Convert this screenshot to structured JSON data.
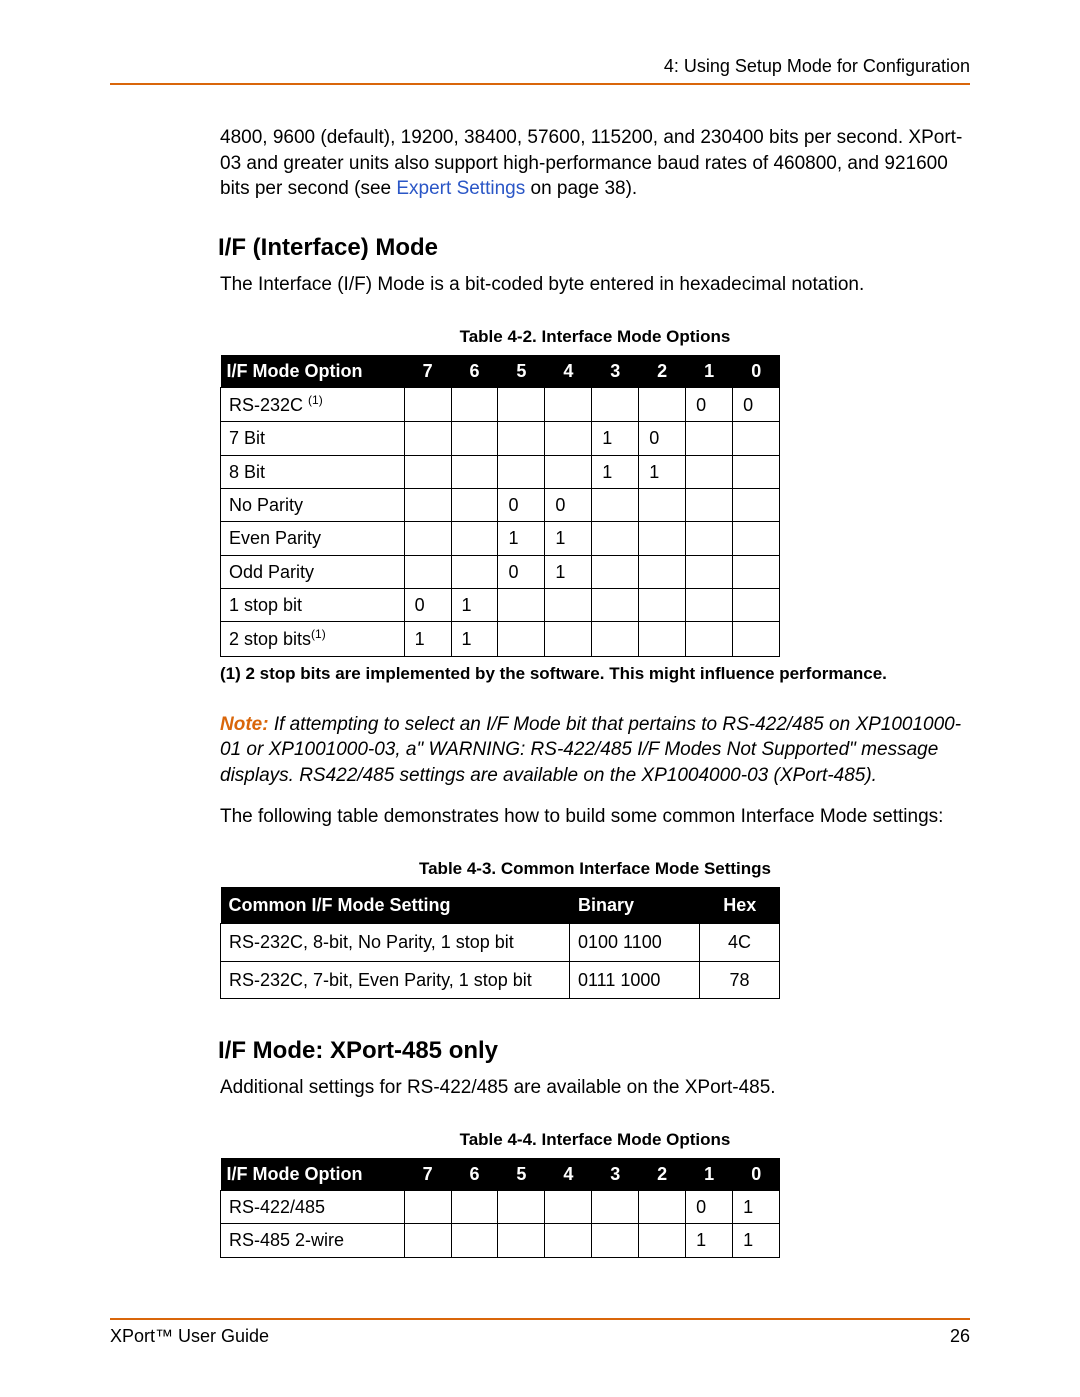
{
  "header": {
    "chapter": "4: Using Setup Mode for Configuration"
  },
  "intro": {
    "rates": "4800, 9600 (default), 19200, 38400, 57600, 115200, and 230400 bits per second. XPort-03 and greater units also support high-performance baud rates of 460800, and 921600 bits per second (see ",
    "link": "Expert Settings",
    "after_link": " on page 38)."
  },
  "section1": {
    "title": "I/F (Interface) Mode",
    "desc": "The Interface (I/F) Mode is a bit-coded byte entered in hexadecimal notation."
  },
  "table1": {
    "caption": "Table 4-2. Interface Mode Options",
    "header_opt": "I/F Mode Option",
    "bits": [
      "7",
      "6",
      "5",
      "4",
      "3",
      "2",
      "1",
      "0"
    ],
    "rows": [
      {
        "label": "RS-232C ",
        "sup": "(1)",
        "cells": [
          "",
          "",
          "",
          "",
          "",
          "",
          "0",
          "0"
        ]
      },
      {
        "label": "7 Bit",
        "cells": [
          "",
          "",
          "",
          "",
          "1",
          "0",
          "",
          ""
        ]
      },
      {
        "label": "8 Bit",
        "cells": [
          "",
          "",
          "",
          "",
          "1",
          "1",
          "",
          ""
        ]
      },
      {
        "label": "No Parity",
        "cells": [
          "",
          "",
          "0",
          "0",
          "",
          "",
          "",
          ""
        ]
      },
      {
        "label": "Even Parity",
        "cells": [
          "",
          "",
          "1",
          "1",
          "",
          "",
          "",
          ""
        ]
      },
      {
        "label": "Odd Parity",
        "cells": [
          "",
          "",
          "0",
          "1",
          "",
          "",
          "",
          ""
        ]
      },
      {
        "label": "1 stop bit",
        "cells": [
          "0",
          "1",
          "",
          "",
          "",
          "",
          "",
          ""
        ]
      },
      {
        "label": "2 stop bits",
        "sup": "(1)",
        "cells": [
          "1",
          "1",
          "",
          "",
          "",
          "",
          "",
          ""
        ]
      }
    ],
    "footnote": "(1) 2 stop bits are implemented by the software. This might influence performance."
  },
  "note": {
    "label": "Note:",
    "text": "  If attempting to select an I/F Mode bit that pertains to RS-422/485 on XP1001000-01 or XP1001000-03, a\" WARNING: RS-422/485 I/F Modes Not Supported\" message displays.  RS422/485 settings are available on the XP1004000-03 (XPort-485)."
  },
  "between_tables": "The following table demonstrates how to build some common Interface Mode settings:",
  "table2": {
    "caption": "Table 4-3. Common Interface Mode Settings",
    "headers": {
      "setting": "Common I/F Mode Setting",
      "binary": "Binary",
      "hex": "Hex"
    },
    "rows": [
      {
        "setting": "RS-232C, 8-bit, No Parity, 1 stop bit",
        "binary": "0100 1100",
        "hex": "4C"
      },
      {
        "setting": "RS-232C, 7-bit, Even Parity, 1 stop bit",
        "binary": "0111 1000",
        "hex": "78"
      }
    ]
  },
  "section2": {
    "title": "I/F Mode: XPort-485 only",
    "desc": "Additional settings for RS-422/485 are available on the XPort-485."
  },
  "table3": {
    "caption": "Table 4-4. Interface Mode Options",
    "header_opt": "I/F Mode Option",
    "bits": [
      "7",
      "6",
      "5",
      "4",
      "3",
      "2",
      "1",
      "0"
    ],
    "rows": [
      {
        "label": "RS-422/485",
        "cells": [
          "",
          "",
          "",
          "",
          "",
          "",
          "0",
          "1"
        ]
      },
      {
        "label": "RS-485 2-wire",
        "cells": [
          "",
          "",
          "",
          "",
          "",
          "",
          "1",
          "1"
        ]
      }
    ]
  },
  "footer": {
    "guide": "XPort™ User Guide",
    "page": "26"
  }
}
